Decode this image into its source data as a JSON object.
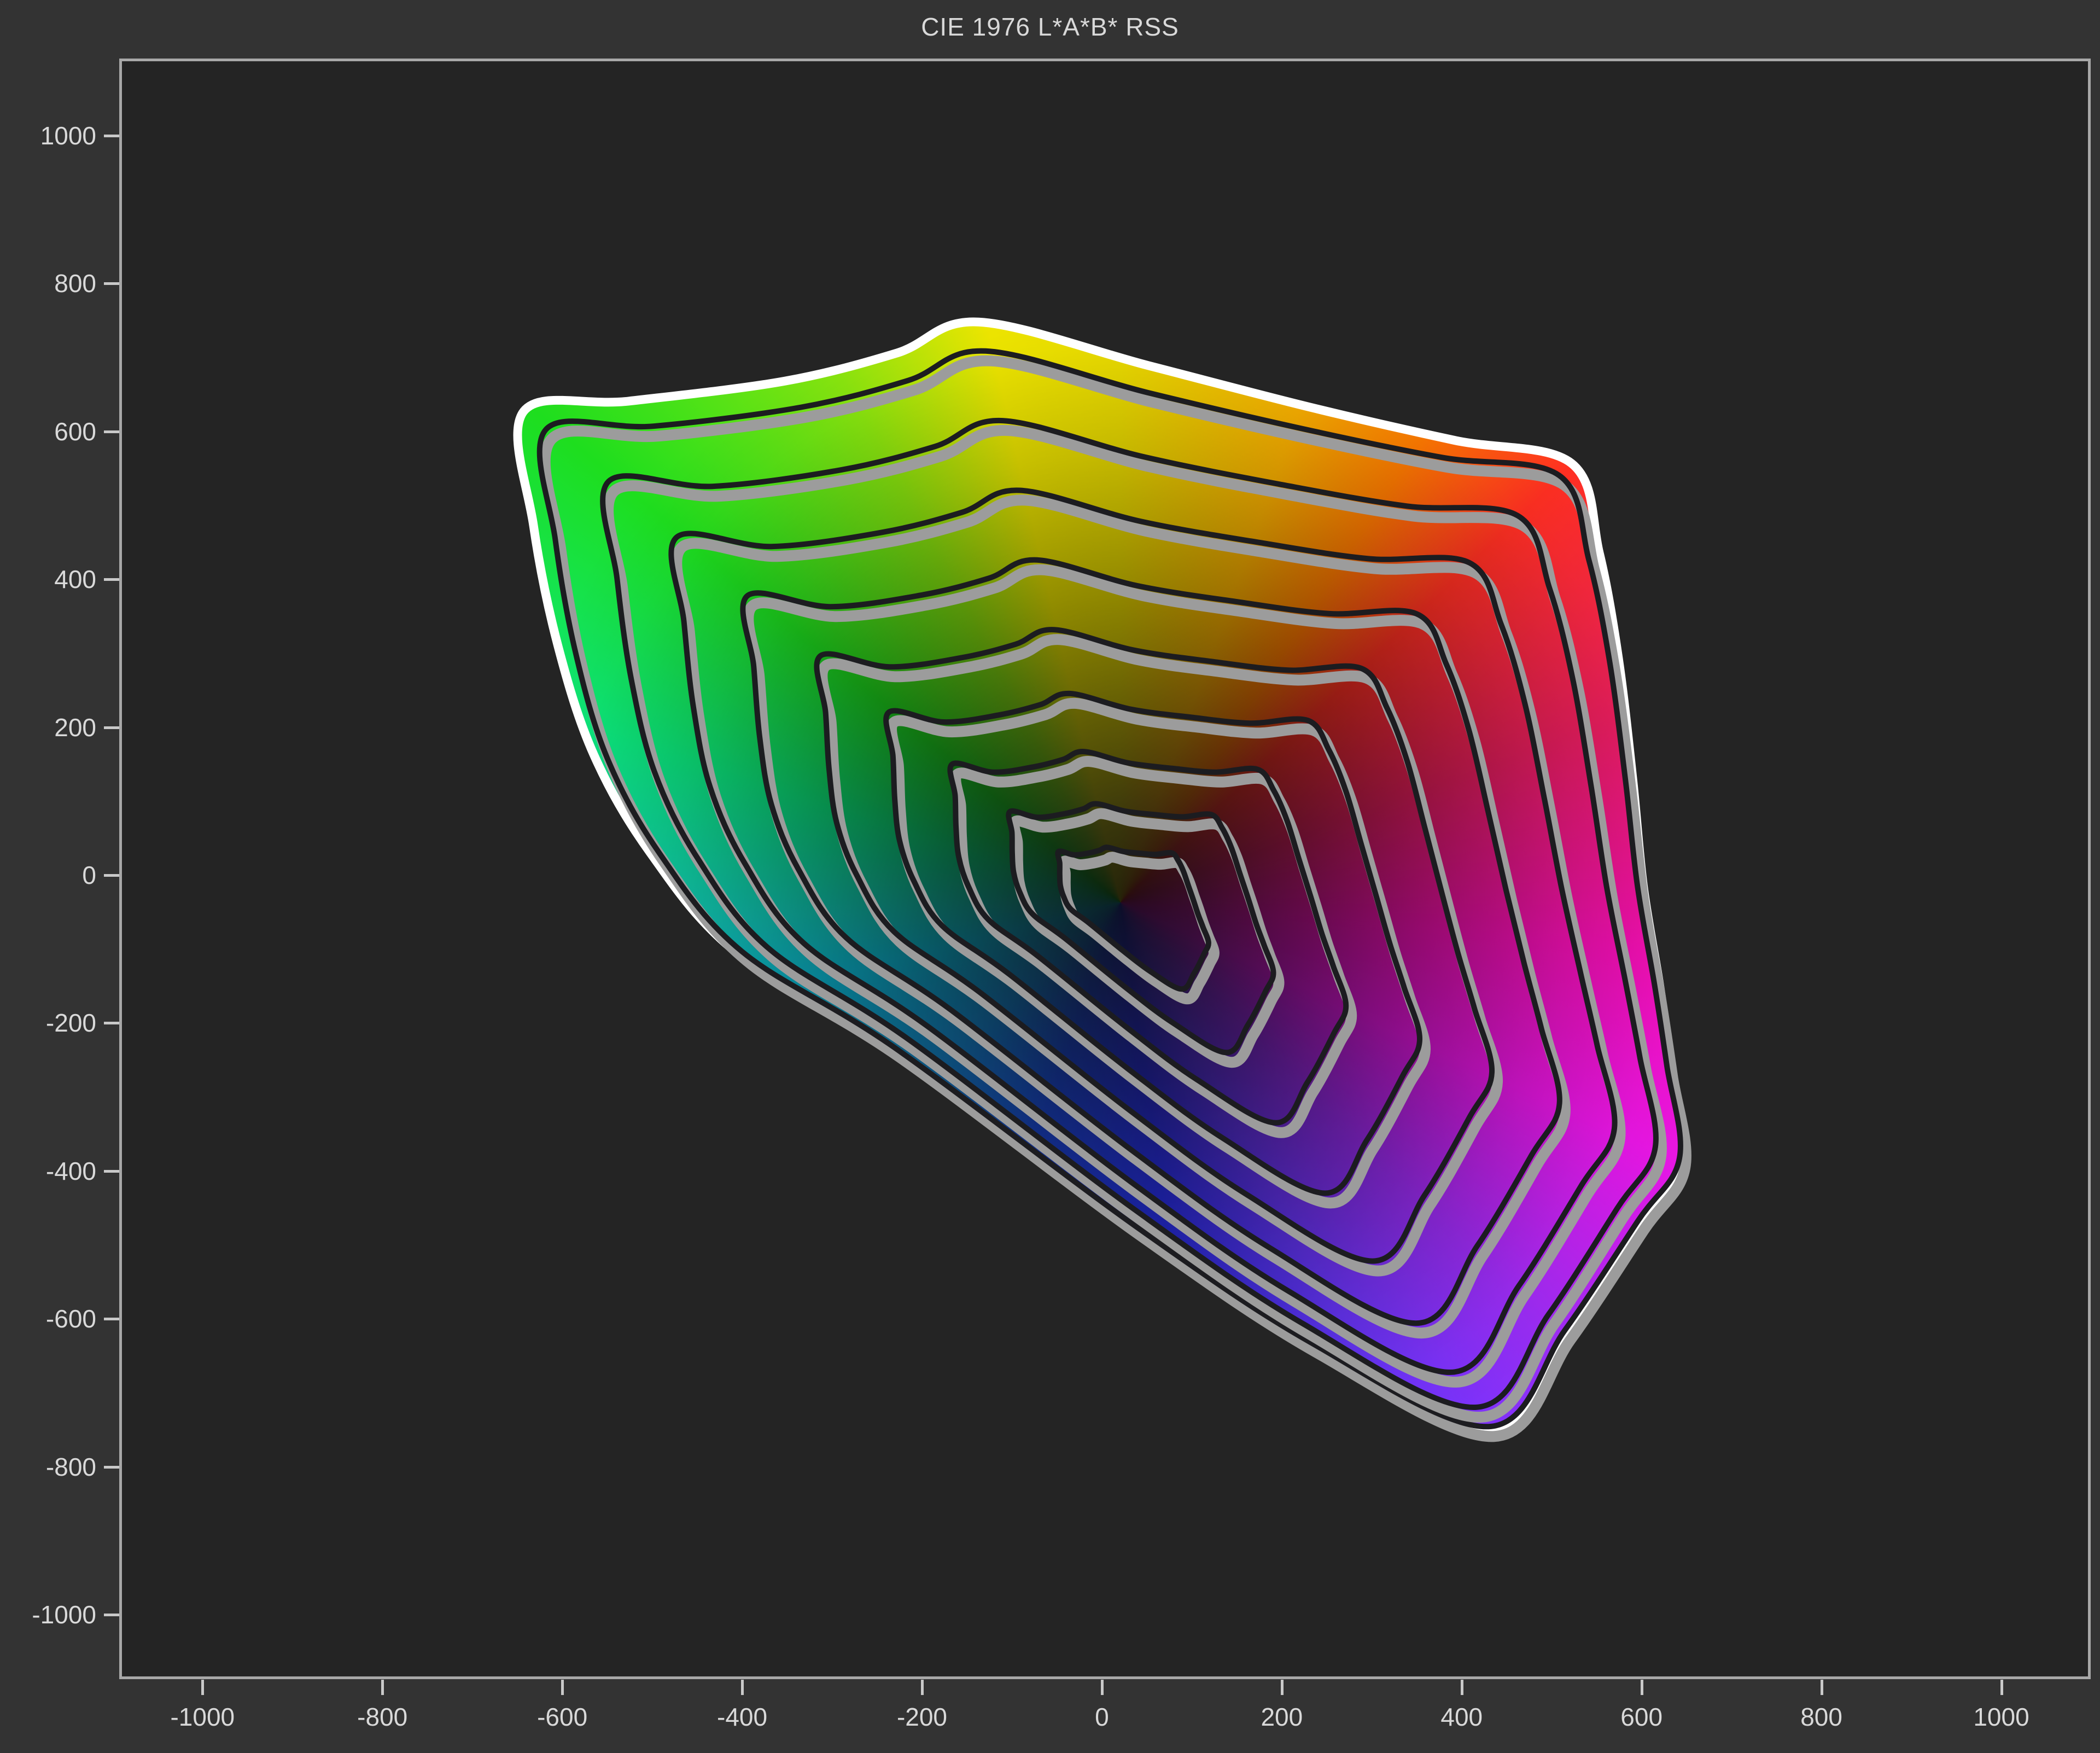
{
  "title": "CIE 1976 L*A*B* RSS",
  "chart_data": {
    "type": "area",
    "title": "CIE 1976 L*A*B* RSS",
    "xlabel": "",
    "ylabel": "",
    "legend": "none",
    "grid": "off",
    "x_ticks": [
      -1000,
      -800,
      -600,
      -400,
      -200,
      0,
      200,
      400,
      600,
      800,
      1000
    ],
    "y_ticks": [
      -1000,
      -800,
      -600,
      -400,
      -200,
      0,
      200,
      400,
      600,
      800,
      1000
    ],
    "x_range": [
      -1092.6,
      1099.4
    ],
    "y_range": [
      -1087.3,
      1104.3
    ],
    "description": "CIELAB a*b* gamut projection: outer white gamut boundary containing 9 nested black lightness-contour rings converging toward a point near the origin, filled with the corresponding hues (green left, yellow top, red/magenta right, blue bottom, cyan lower-left), darkening toward the center.",
    "rings_center_ab": [
      21,
      -37
    ],
    "ring_count": 9,
    "ring_ratios": [
      0.95,
      0.83,
      0.71,
      0.59,
      0.47,
      0.36,
      0.26,
      0.17,
      0.095
    ],
    "boundary": [
      {
        "a": -643,
        "b": 627,
        "p": 1.1
      },
      {
        "a": -526,
        "b": 641,
        "p": 1.0
      },
      {
        "a": -353,
        "b": 668,
        "p": 1.0
      },
      {
        "a": -228,
        "b": 706,
        "p": 1.0
      },
      {
        "a": -137,
        "b": 748,
        "p": 1.0
      },
      {
        "a": 52,
        "b": 689,
        "p": 1.0
      },
      {
        "a": 234,
        "b": 632,
        "p": 1.05
      },
      {
        "a": 392,
        "b": 588,
        "p": 1.1
      },
      {
        "a": 522,
        "b": 557,
        "p": 1.2
      },
      {
        "a": 553,
        "b": 436,
        "p": 1.28
      },
      {
        "a": 574,
        "b": 296,
        "p": 1.35
      },
      {
        "a": 590,
        "b": 133,
        "p": 1.42
      },
      {
        "a": 602,
        "b": -15,
        "p": 1.5
      },
      {
        "a": 620,
        "b": -148,
        "p": 1.55
      },
      {
        "a": 633,
        "b": -260,
        "p": 1.62
      },
      {
        "a": 646,
        "b": -385,
        "p": 1.7
      },
      {
        "a": 599,
        "b": -470,
        "p": 1.75
      },
      {
        "a": 517,
        "b": -618,
        "p": 1.8
      },
      {
        "a": 432,
        "b": -749,
        "p": 1.8
      },
      {
        "a": 234,
        "b": -636,
        "p": 1.7
      },
      {
        "a": 36,
        "b": -477,
        "p": 1.6
      },
      {
        "a": -234,
        "b": -235,
        "p": 1.5
      },
      {
        "a": -407,
        "b": -104,
        "p": 1.4
      },
      {
        "a": -502,
        "b": 30,
        "p": 1.3
      },
      {
        "a": -565,
        "b": 163,
        "p": 1.22
      },
      {
        "a": -605,
        "b": 311,
        "p": 1.15
      },
      {
        "a": -632,
        "b": 473,
        "p": 1.1
      }
    ],
    "hue_wheel_stops": [
      [
        0,
        "#f0e000"
      ],
      [
        20,
        "#ffb300"
      ],
      [
        33,
        "#ff7a00"
      ],
      [
        46,
        "#ff2f22"
      ],
      [
        70,
        "#ef1e62"
      ],
      [
        95,
        "#fa10b8"
      ],
      [
        115,
        "#ea16e6"
      ],
      [
        135,
        "#9c2cf4"
      ],
      [
        152,
        "#6a36ff"
      ],
      [
        172,
        "#2c33ff"
      ],
      [
        200,
        "#1e56ff"
      ],
      [
        228,
        "#17a0f8"
      ],
      [
        256,
        "#0dd2f0"
      ],
      [
        268,
        "#12dcc8"
      ],
      [
        288,
        "#0ce87e"
      ],
      [
        310,
        "#1ede1e"
      ],
      [
        332,
        "#8ae60e"
      ],
      [
        347,
        "#f2ea00"
      ],
      [
        360,
        "#f0e000"
      ]
    ],
    "center_shade_stops": [
      [
        0,
        "rgba(8,8,10,0.88)"
      ],
      [
        140,
        "rgba(10,10,14,0.80)"
      ],
      [
        330,
        "rgba(5,5,8,0.62)"
      ],
      [
        560,
        "rgba(0,0,0,0.40)"
      ],
      [
        820,
        "rgba(0,0,0,0.18)"
      ],
      [
        1020,
        "rgba(0,0,0,0.04)"
      ],
      [
        1150,
        "rgba(0,0,0,0.0)"
      ]
    ]
  },
  "colors": {
    "page_bg": "#333333",
    "plot_bg": "#242424",
    "plot_border": "#a8a8a8",
    "tick_mark": "#c9c9c9",
    "tick_label": "#d9d9d9",
    "title_text": "#d9d9d9",
    "gamut_outer_stroke": "#ffffff",
    "ring_stroke": "#1c1c20",
    "ring_shadow": "#9c9c9c"
  }
}
